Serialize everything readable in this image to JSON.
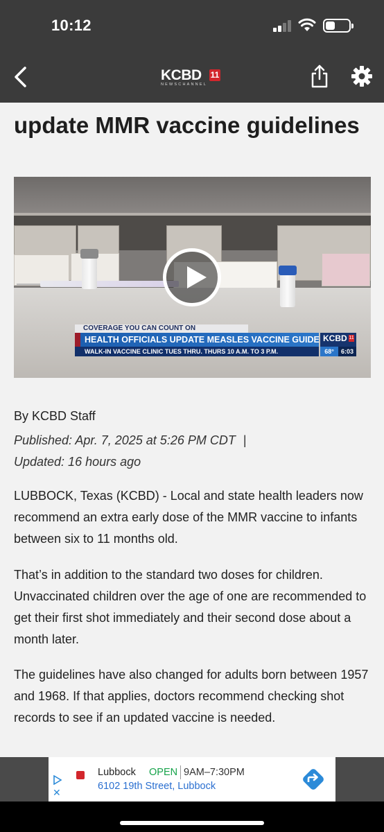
{
  "status_bar": {
    "time": "10:12"
  },
  "app_header": {
    "logo_word": "KCBD",
    "logo_number": "11",
    "logo_sub": "NEWSCHANNEL",
    "icons": [
      "back-chevron-icon",
      "share-icon",
      "gear-icon"
    ]
  },
  "article": {
    "headline": "update MMR vaccine guidelines",
    "video": {
      "icon": "play-icon",
      "lower_third": {
        "tagline": "COVERAGE YOU CAN COUNT ON",
        "headline": "HEALTH OFFICIALS UPDATE MEASLES VACCINE GUIDELINES",
        "subline": "WALK-IN VACCINE CLINIC TUES THRU. THURS 10 A.M. TO 3 P.M.",
        "station": "KCBD",
        "station_number": "11",
        "temperature": "68°",
        "clock": "6:03"
      }
    },
    "byline": "By KCBD Staff",
    "published": "Published: Apr. 7, 2025 at 5:26 PM CDT",
    "separator": "|",
    "updated": "Updated: 16 hours ago",
    "paragraphs": [
      "LUBBOCK, Texas (KCBD) - Local and state health leaders now recommend an extra early dose of the MMR vaccine to infants between six to 11 months old.",
      "That’s in addition to the standard two doses for children. Unvaccinated children over the age of one are recommended to get their first shot immediately and their second dose about a month later.",
      "The guidelines have also changed for adults born between 1957 and 1968. If that applies, doctors recommend checking shot records to see if an updated vaccine is needed."
    ]
  },
  "ad": {
    "city": "Lubbock",
    "status": "OPEN",
    "hours": "9AM–7:30PM",
    "address": "6102 19th Street, Lubbock",
    "close_glyph": "✕",
    "colors": {
      "open": "#16a34a",
      "address": "#2a6fd0",
      "directions": "#2b8ad8"
    }
  }
}
